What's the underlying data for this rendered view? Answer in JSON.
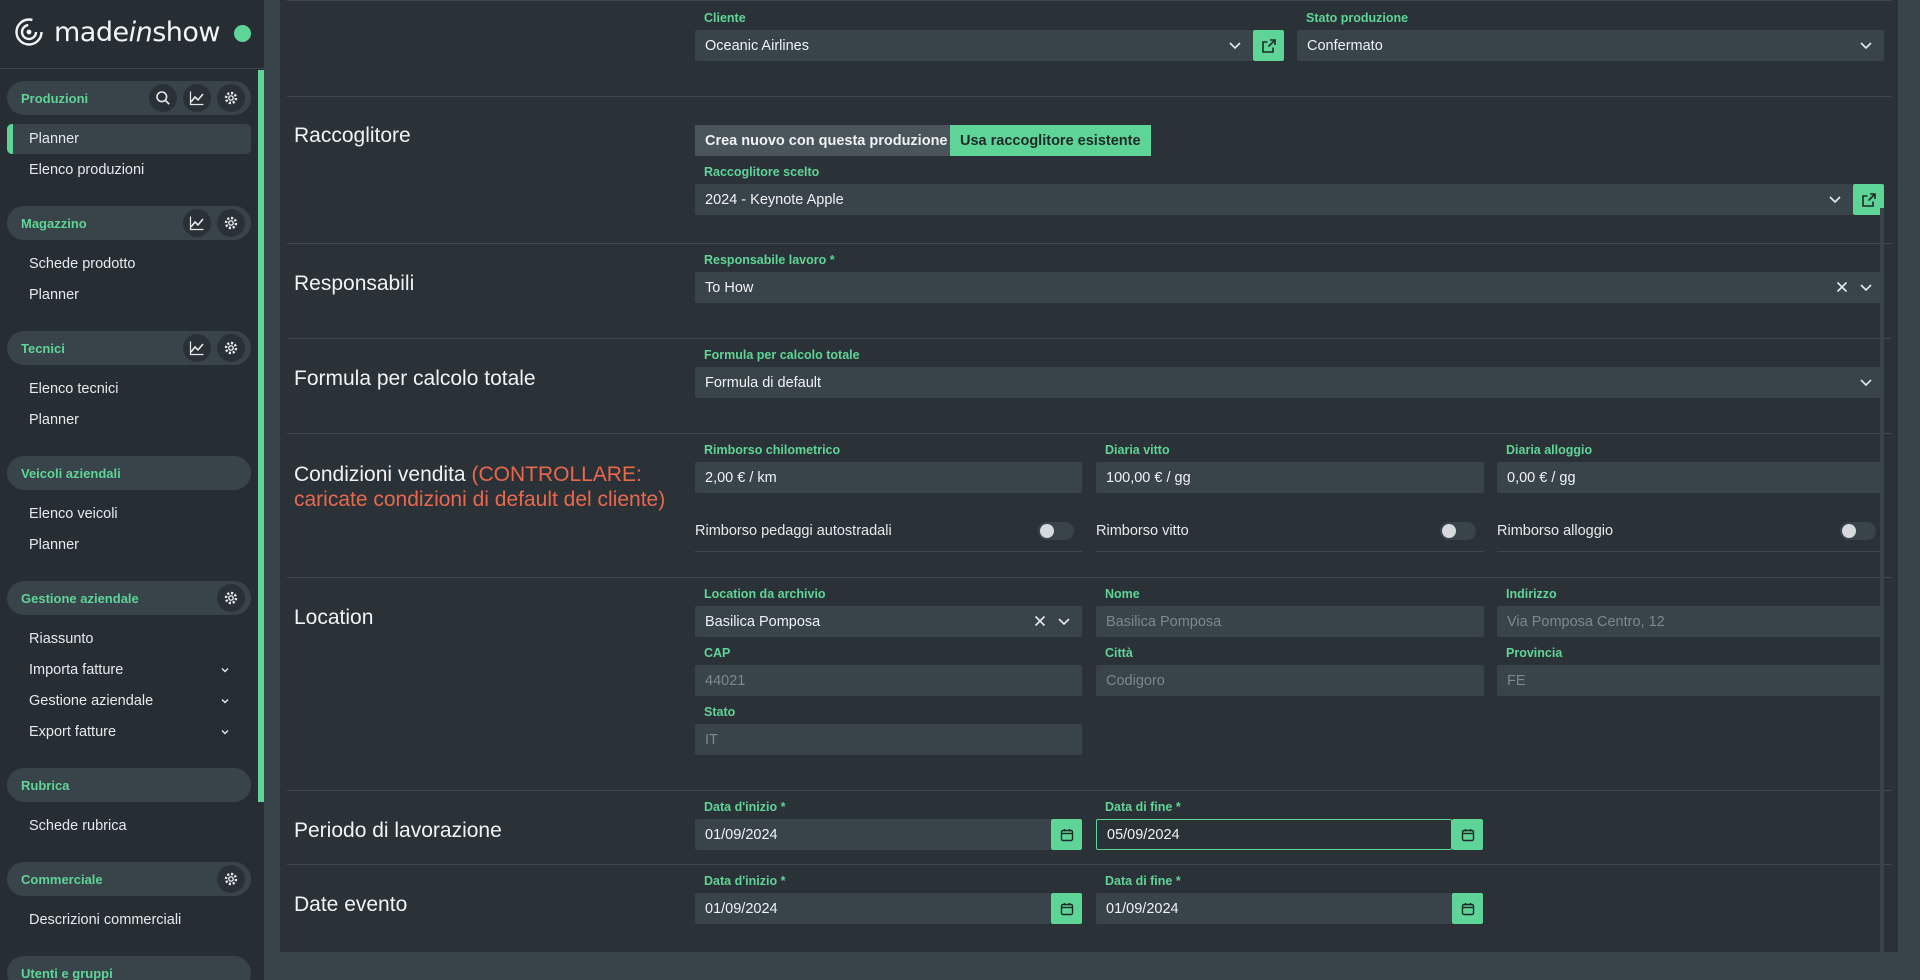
{
  "app": {
    "logo_text_1": "made",
    "logo_text_2": "in",
    "logo_text_3": "show"
  },
  "sidebar": {
    "groups": [
      {
        "label": "Produzioni",
        "items": [
          "Planner",
          "Elenco produzioni"
        ]
      },
      {
        "label": "Magazzino",
        "items": [
          "Schede prodotto",
          "Planner"
        ]
      },
      {
        "label": "Tecnici",
        "items": [
          "Elenco tecnici",
          "Planner"
        ]
      },
      {
        "label": "Veicoli aziendali",
        "items": [
          "Elenco veicoli",
          "Planner"
        ]
      },
      {
        "label": "Gestione aziendale",
        "items": [
          "Riassunto",
          "Importa fatture",
          "Gestione aziendale",
          "Export fatture"
        ]
      },
      {
        "label": "Rubrica",
        "items": [
          "Schede rubrica"
        ]
      },
      {
        "label": "Commerciale",
        "items": [
          "Descrizioni commerciali"
        ]
      },
      {
        "label": "Utenti e gruppi",
        "items": []
      }
    ]
  },
  "form": {
    "cliente": {
      "label": "Cliente",
      "value": "Oceanic Airlines"
    },
    "stato_produzione": {
      "label": "Stato produzione",
      "value": "Confermato"
    },
    "raccoglitore": {
      "title": "Raccoglitore",
      "option_new": "Crea nuovo con questa produzione",
      "option_existing": "Usa raccoglitore esistente",
      "selected_label": "Raccoglitore scelto",
      "selected_value": "2024 - Keynote Apple"
    },
    "responsabili": {
      "title": "Responsabili",
      "label": "Responsabile lavoro *",
      "value": "To How"
    },
    "formula": {
      "title": "Formula per calcolo totale",
      "label": "Formula per calcolo totale",
      "value": "Formula di default"
    },
    "condizioni": {
      "title": "Condizioni vendita",
      "warning_1": "(CONTROLLARE:",
      "warning_2": "caricate condizioni di default del cliente)",
      "rimborso_km_label": "Rimborso chilometrico",
      "rimborso_km_value": "2,00 € / km",
      "diaria_vitto_label": "Diaria vitto",
      "diaria_vitto_value": "100,00 € / gg",
      "diaria_alloggio_label": "Diaria alloggio",
      "diaria_alloggio_value": "0,00 € / gg",
      "toggle_pedaggi": "Rimborso pedaggi autostradali",
      "toggle_vitto": "Rimborso vitto",
      "toggle_alloggio": "Rimborso alloggio"
    },
    "location": {
      "title": "Location",
      "archivio_label": "Location da archivio",
      "archivio_value": "Basilica Pomposa",
      "nome_label": "Nome",
      "nome_value": "Basilica Pomposa",
      "indirizzo_label": "Indirizzo",
      "indirizzo_value": "Via Pomposa Centro, 12",
      "cap_label": "CAP",
      "cap_value": "44021",
      "citta_label": "Città",
      "citta_value": "Codigoro",
      "provincia_label": "Provincia",
      "provincia_value": "FE",
      "stato_label": "Stato",
      "stato_value": "IT"
    },
    "periodo": {
      "title": "Periodo di lavorazione",
      "start_label": "Data d'inizio *",
      "start_value": "01/09/2024",
      "end_label": "Data di fine *",
      "end_value": "05/09/2024"
    },
    "date_evento": {
      "title": "Date evento",
      "start_label": "Data d'inizio *",
      "start_value": "01/09/2024",
      "end_label": "Data di fine *",
      "end_value": "01/09/2024"
    }
  },
  "colors": {
    "accent": "#5ed497",
    "warning": "#e8684e",
    "panel": "#2b3237",
    "field": "#39434a"
  }
}
